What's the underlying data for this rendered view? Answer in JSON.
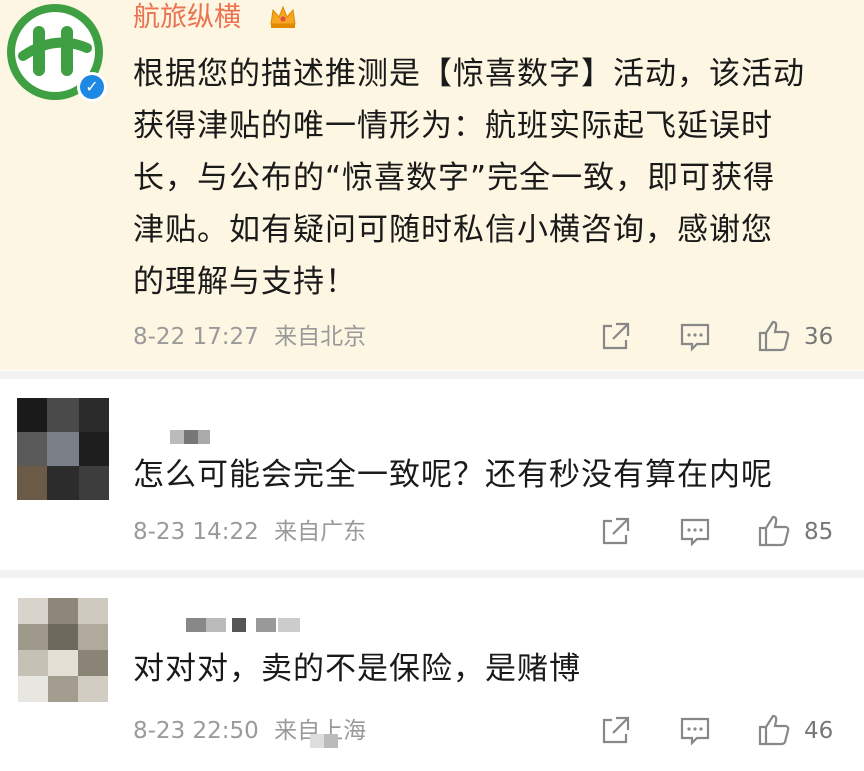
{
  "comments": [
    {
      "username": "航旅纵横",
      "text_lines": [
        "根据您的描述推测是【惊喜数字】活动，该活动",
        "获得津贴的唯一情形为：航班实际起飞延误时",
        "长，与公布的“惊喜数字”完全一致，即可获得",
        "津贴。如有疑问可随时私信小横咨询，感谢您",
        "的理解与支持！"
      ],
      "time": "8-22 17:27",
      "location": "来自北京",
      "likes": "36",
      "avatar_icon": "green-logo-icon",
      "badge_icon": "verified-badge-icon"
    },
    {
      "username": "",
      "text_lines": [
        "怎么可能会完全一致呢？还有秒没有算在内呢"
      ],
      "time": "8-23 14:22",
      "location": "来自广东",
      "likes": "85",
      "avatar_icon": "pixelated-avatar-icon"
    },
    {
      "username": "",
      "text_lines": [
        "对对对，卖的不是保险，是赌博"
      ],
      "time": "8-23 22:50",
      "location": "来自上海",
      "likes": "46",
      "avatar_icon": "pixelated-avatar-icon"
    }
  ],
  "colors": {
    "highlight_bg": "#fdf6e3",
    "username": "#eb7350",
    "meta": "#9a9a9a",
    "brand_green": "#3ea043",
    "verified_blue": "#1e88e5"
  }
}
